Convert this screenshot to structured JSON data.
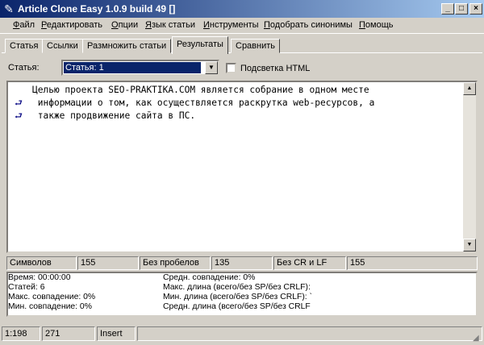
{
  "window": {
    "title": "Article Clone Easy 1.0.9 build 49 []",
    "minimize_label": "_",
    "maximize_label": "□",
    "close_label": "×"
  },
  "menu": [
    "Файл",
    "Редактировать",
    "Опции",
    "Язык статьи",
    "Инструменты",
    "Подобрать синонимы",
    "Помощь"
  ],
  "tabs": [
    {
      "label": "Статья"
    },
    {
      "label": "Ссылки"
    },
    {
      "label": "Размножить статьи"
    },
    {
      "label": "Результаты",
      "active": true
    },
    {
      "label": "Сравнить"
    }
  ],
  "article": {
    "label": "Статья:",
    "selected": "Статья: 1",
    "highlight_label": "Подсветка HTML",
    "highlight_checked": false
  },
  "editor": {
    "lines": [
      "Целью проекта SEO-PRAKTIKA.COM является собрание в одном месте",
      " информации о том, как осуществляется раскрутка web-ресурсов, а",
      " также продвижение сайта в ПС."
    ],
    "wrap_icon": "wrap-arrow-icon"
  },
  "stats": {
    "chars_label": "Символов",
    "chars_value": "155",
    "no_spaces_label": "Без пробелов",
    "no_spaces_value": "135",
    "no_crlf_label": "Без CR и LF",
    "no_crlf_value": "155"
  },
  "info": {
    "left": [
      "Время: 00:00:00",
      "Статей: 6",
      "Макс. совпадение: 0%",
      "Мин. совпадение: 0%"
    ],
    "right": [
      "Средн. совпадение: 0%",
      "Макс. длина (всего/без SP/без CRLF):",
      "Мин. длина (всего/без SP/без CRLF): `",
      "Средн. длина (всего/без SP/без CRLF"
    ]
  },
  "statusbar": {
    "position": "1:198",
    "length": "271",
    "mode": "Insert"
  },
  "colors": {
    "titlebar_start": "#0a246a",
    "titlebar_end": "#a6caf0",
    "selection": "#0a246a",
    "face": "#d4d0c8"
  }
}
